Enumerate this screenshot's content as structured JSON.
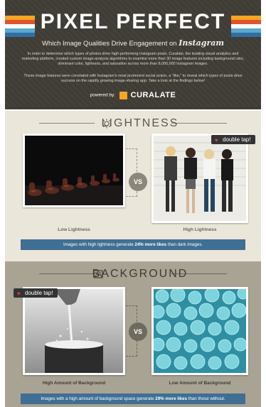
{
  "header": {
    "title": "PIXEL PERFECT",
    "subtitle": "Which Image Qualities Drive Engagement on",
    "subtitle_brand": "Instagram",
    "intro_1": "In order to determine which types of photos drive high-performing Instagram posts, Curalate, the leading visual analytics and marketing platform, created custom image-analysis algorithms to examine more than 30 image features including background ratio, dominant color, lightness, and saturation across more than 8,000,000 Instagram images.",
    "intro_2": "These image features were correlated with Instagram's most prominent social action, a \"like,\" to reveal which types of posts drive success on the rapidly growing image-sharing app. Take a look at the findings below!",
    "powered_by": "powered by:",
    "brand": "CURALATE"
  },
  "lightness": {
    "title": "LIGHTNESS",
    "left_caption": "Low Lightness",
    "right_caption": "High Lightness",
    "vs": "VS",
    "tag": "double tap!",
    "result_pre": "Images with high lightness generate ",
    "result_bold": "24% more likes",
    "result_post": " than dark images."
  },
  "background": {
    "title": "BACKGROUND",
    "left_caption": "High Amount of Background",
    "right_caption": "Low Amount of Background",
    "vs": "VS",
    "tag": "double tap!",
    "result_pre": "Images with a high amount of background space generate ",
    "result_bold": "29% more likes",
    "result_post": " than those without."
  },
  "colors": {
    "header_bg": "#3f3c35",
    "section1_bg": "#ebe6da",
    "section2_bg": "#a9a394",
    "result_bar": "#3f6f93",
    "accent_orange": "#f5a623",
    "heart_red": "#e0413a"
  }
}
